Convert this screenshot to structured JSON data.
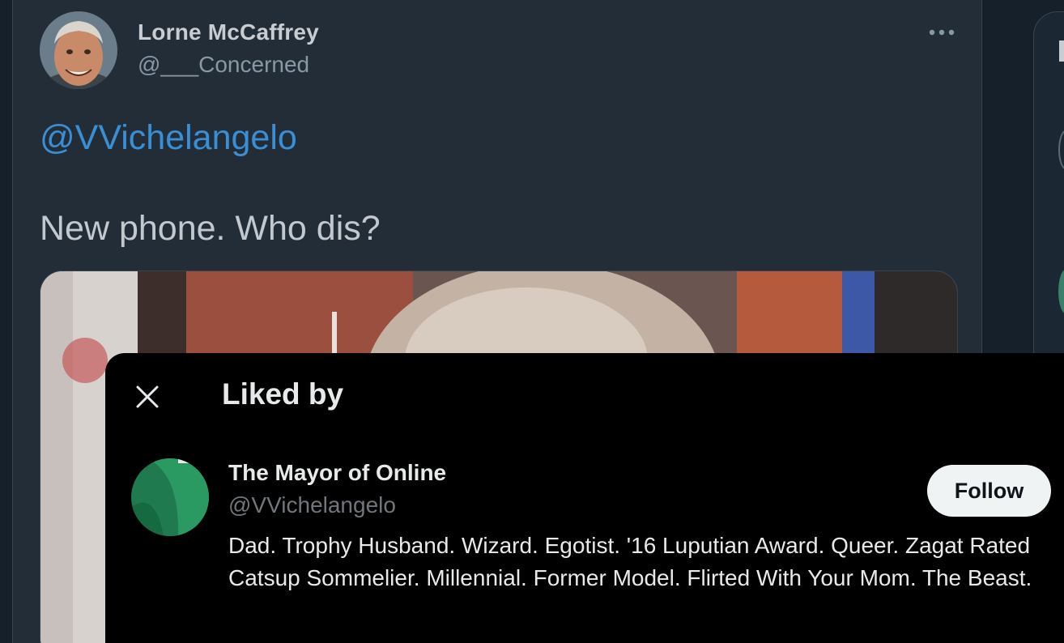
{
  "tweet": {
    "author_name": "Lorne McCaffrey",
    "author_handle": "@___Concerned",
    "mention": "@VVichelangelo",
    "text": "New phone. Who dis?"
  },
  "modal": {
    "title": "Liked by",
    "users": [
      {
        "name": "The Mayor of Online",
        "handle": "@VVichelangelo",
        "follow_label": "Follow",
        "bio": "Dad. Trophy Husband. Wizard. Egotist. '16 Luputian Award. Queer. Zagat Rated Catsup Sommelier. Millennial. Former Model. Flirted With Your Mom. The Beast."
      }
    ]
  },
  "colors": {
    "background": "#15202b",
    "tweet_bg": "#232d38",
    "link": "#3a8ed4",
    "modal_bg": "#000000",
    "follow_bg": "#eff3f4"
  },
  "icons": {
    "more": "more-horizontal-icon",
    "close": "close-icon"
  }
}
